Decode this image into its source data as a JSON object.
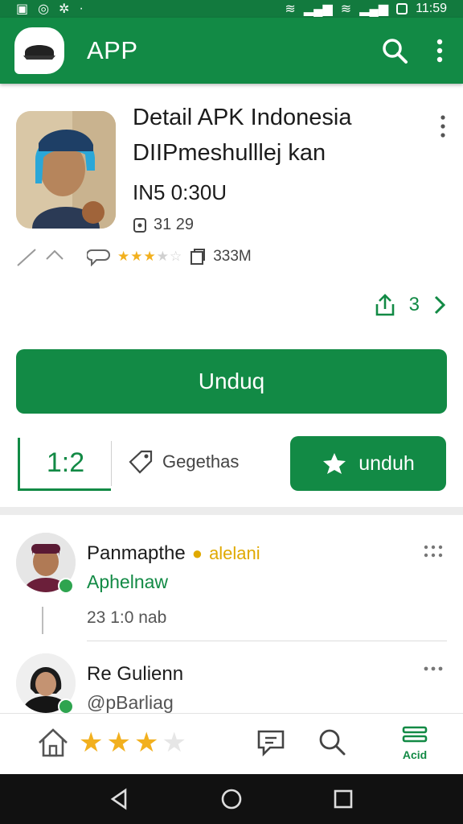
{
  "statusbar": {
    "time": "11:59"
  },
  "appbar": {
    "title": "APP"
  },
  "app": {
    "title_line1": "Detail APK Indonesia",
    "title_line2": "DIIPmeshulllej kan",
    "code": "IN5 0:30U",
    "downloads": "31 29",
    "size": "333M",
    "rating_stars": 3.5,
    "share_count": "3"
  },
  "buttons": {
    "download": "Unduq",
    "unduh": "unduh"
  },
  "stats": {
    "version": "1:2",
    "tags": "Gegethas"
  },
  "reviews": [
    {
      "name": "Panmapthe",
      "badge": "alelani",
      "handle": "Aphelnaw",
      "time": "23",
      "time2": "1:0 nab"
    },
    {
      "name": "Re Gulienn",
      "handle": "@pBarliag"
    }
  ],
  "bottom": {
    "rating": 3,
    "acc_label": "Acid"
  },
  "colors": {
    "primary": "#128a45",
    "star": "#f2b01e"
  }
}
